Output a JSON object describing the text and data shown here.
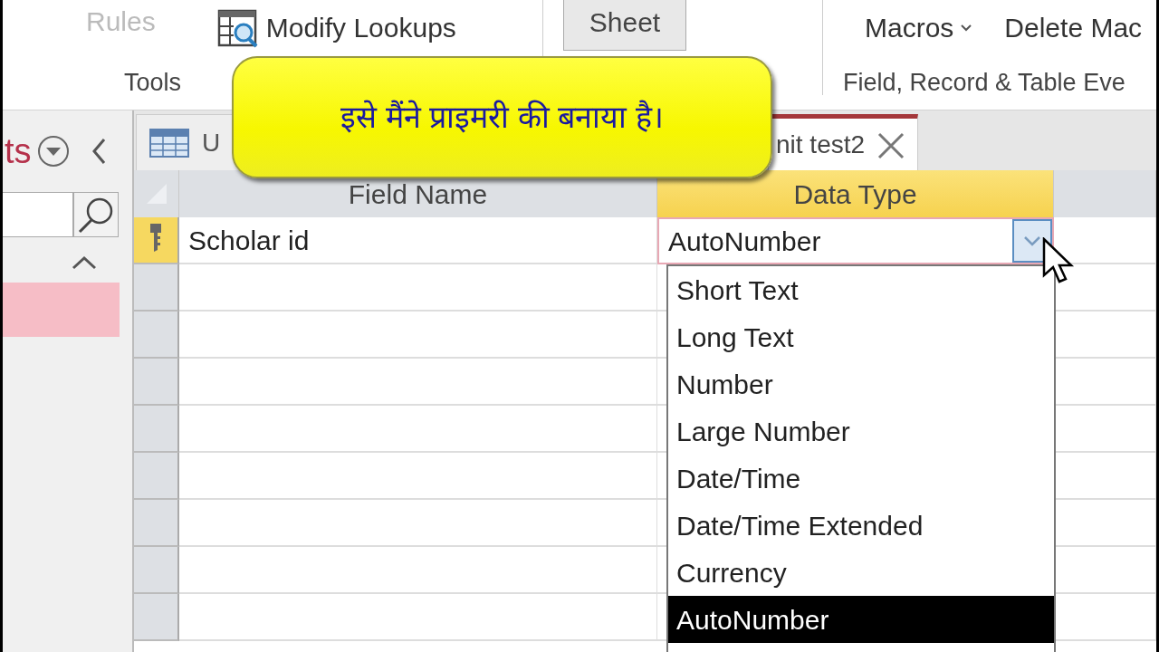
{
  "ribbon": {
    "tools_group": {
      "label": "Tools",
      "buttons": [
        {
          "label": "Rules",
          "kind": "plain",
          "disabled": true
        },
        {
          "label": "Modify Lookups",
          "kind": "lookup",
          "disabled": false
        }
      ]
    },
    "property_sheet": {
      "label": "Sheet",
      "pressed": true
    },
    "events_group": {
      "label": "Field, Record & Table Eve",
      "buttons": [
        {
          "label": "Macros",
          "kind": "menu",
          "disabled": false
        },
        {
          "label": "Delete Mac",
          "kind": "plain",
          "disabled": false
        }
      ]
    }
  },
  "nav_pane": {
    "title": "ts",
    "items": [
      {
        "selected": true
      }
    ]
  },
  "tabs": [
    {
      "label": "U",
      "selected": false
    },
    {
      "label": "nit test2",
      "selected": true
    }
  ],
  "table": {
    "columns": [
      {
        "label": "Field Name",
        "selected": false
      },
      {
        "label": "Data Type",
        "selected": true
      }
    ],
    "rows": [
      {
        "field_name": "Scholar id",
        "data_type": "AutoNumber",
        "primary_key": true,
        "selected": true
      }
    ]
  },
  "dropdown": {
    "options": [
      {
        "label": "Short Text",
        "selected": false
      },
      {
        "label": "Long Text",
        "selected": false
      },
      {
        "label": "Number",
        "selected": false
      },
      {
        "label": "Large Number",
        "selected": false
      },
      {
        "label": "Date/Time",
        "selected": false
      },
      {
        "label": "Date/Time Extended",
        "selected": false
      },
      {
        "label": "Currency",
        "selected": false
      },
      {
        "label": "AutoNumber",
        "selected": true
      }
    ]
  },
  "callout": {
    "text": "इसे मैंने प्राइमरी की बनाया है।"
  }
}
